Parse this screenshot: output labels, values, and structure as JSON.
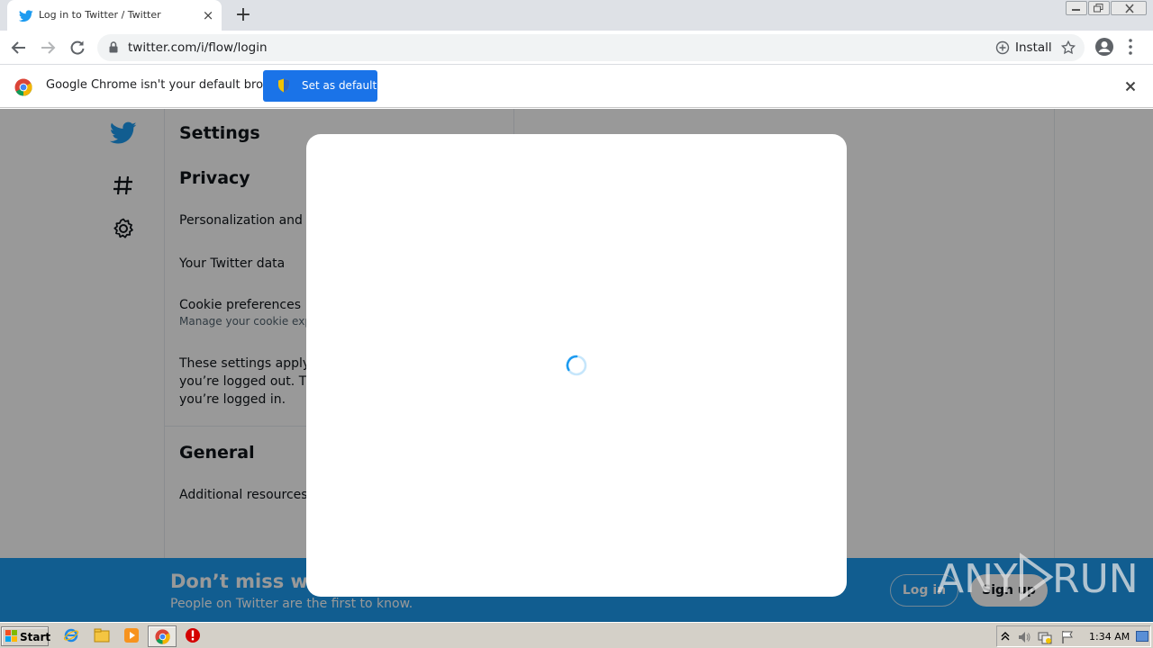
{
  "browser": {
    "tab_title": "Log in to Twitter / Twitter",
    "url": "twitter.com/i/flow/login",
    "install_label": "Install"
  },
  "infobar": {
    "message": "Google Chrome isn't your default browser",
    "button_label": "Set as default"
  },
  "settings": {
    "title": "Settings",
    "privacy_heading": "Privacy",
    "items": [
      "Personalization and d",
      "Your Twitter data",
      "Cookie preferences"
    ],
    "cookie_sub": "Manage your cookie exp",
    "para_lines": [
      "These settings apply t",
      "you’re logged out. Th",
      "you’re logged in."
    ],
    "general_heading": "General",
    "general_items": [
      "Additional resources"
    ]
  },
  "bottom_bar": {
    "headline": "Don’t miss wh",
    "subline": "People on Twitter are the first to know.",
    "login_label": "Log in",
    "signup_label": "Sign up"
  },
  "watermark": {
    "text_left": "ANY",
    "text_right": "RUN"
  },
  "taskbar": {
    "start_label": "Start",
    "clock": "1:34 AM"
  },
  "colors": {
    "twitter_blue": "#1d9bf0",
    "chrome_blue": "#1a73e8"
  }
}
